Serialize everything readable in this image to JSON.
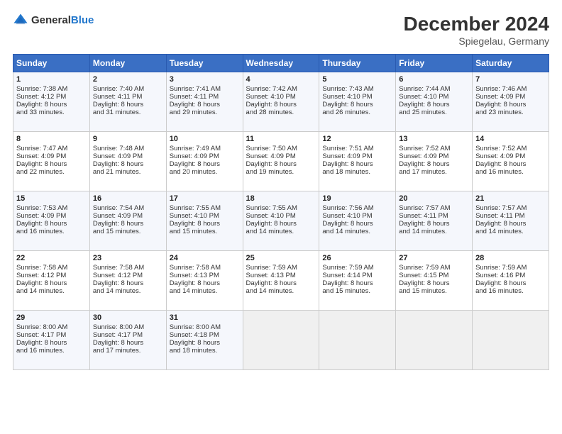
{
  "header": {
    "logo_general": "General",
    "logo_blue": "Blue",
    "month_title": "December 2024",
    "location": "Spiegelau, Germany"
  },
  "weekdays": [
    "Sunday",
    "Monday",
    "Tuesday",
    "Wednesday",
    "Thursday",
    "Friday",
    "Saturday"
  ],
  "weeks": [
    [
      {
        "day": "1",
        "lines": [
          "Sunrise: 7:38 AM",
          "Sunset: 4:12 PM",
          "Daylight: 8 hours",
          "and 33 minutes."
        ]
      },
      {
        "day": "2",
        "lines": [
          "Sunrise: 7:40 AM",
          "Sunset: 4:11 PM",
          "Daylight: 8 hours",
          "and 31 minutes."
        ]
      },
      {
        "day": "3",
        "lines": [
          "Sunrise: 7:41 AM",
          "Sunset: 4:11 PM",
          "Daylight: 8 hours",
          "and 29 minutes."
        ]
      },
      {
        "day": "4",
        "lines": [
          "Sunrise: 7:42 AM",
          "Sunset: 4:10 PM",
          "Daylight: 8 hours",
          "and 28 minutes."
        ]
      },
      {
        "day": "5",
        "lines": [
          "Sunrise: 7:43 AM",
          "Sunset: 4:10 PM",
          "Daylight: 8 hours",
          "and 26 minutes."
        ]
      },
      {
        "day": "6",
        "lines": [
          "Sunrise: 7:44 AM",
          "Sunset: 4:10 PM",
          "Daylight: 8 hours",
          "and 25 minutes."
        ]
      },
      {
        "day": "7",
        "lines": [
          "Sunrise: 7:46 AM",
          "Sunset: 4:09 PM",
          "Daylight: 8 hours",
          "and 23 minutes."
        ]
      }
    ],
    [
      {
        "day": "8",
        "lines": [
          "Sunrise: 7:47 AM",
          "Sunset: 4:09 PM",
          "Daylight: 8 hours",
          "and 22 minutes."
        ]
      },
      {
        "day": "9",
        "lines": [
          "Sunrise: 7:48 AM",
          "Sunset: 4:09 PM",
          "Daylight: 8 hours",
          "and 21 minutes."
        ]
      },
      {
        "day": "10",
        "lines": [
          "Sunrise: 7:49 AM",
          "Sunset: 4:09 PM",
          "Daylight: 8 hours",
          "and 20 minutes."
        ]
      },
      {
        "day": "11",
        "lines": [
          "Sunrise: 7:50 AM",
          "Sunset: 4:09 PM",
          "Daylight: 8 hours",
          "and 19 minutes."
        ]
      },
      {
        "day": "12",
        "lines": [
          "Sunrise: 7:51 AM",
          "Sunset: 4:09 PM",
          "Daylight: 8 hours",
          "and 18 minutes."
        ]
      },
      {
        "day": "13",
        "lines": [
          "Sunrise: 7:52 AM",
          "Sunset: 4:09 PM",
          "Daylight: 8 hours",
          "and 17 minutes."
        ]
      },
      {
        "day": "14",
        "lines": [
          "Sunrise: 7:52 AM",
          "Sunset: 4:09 PM",
          "Daylight: 8 hours",
          "and 16 minutes."
        ]
      }
    ],
    [
      {
        "day": "15",
        "lines": [
          "Sunrise: 7:53 AM",
          "Sunset: 4:09 PM",
          "Daylight: 8 hours",
          "and 16 minutes."
        ]
      },
      {
        "day": "16",
        "lines": [
          "Sunrise: 7:54 AM",
          "Sunset: 4:09 PM",
          "Daylight: 8 hours",
          "and 15 minutes."
        ]
      },
      {
        "day": "17",
        "lines": [
          "Sunrise: 7:55 AM",
          "Sunset: 4:10 PM",
          "Daylight: 8 hours",
          "and 15 minutes."
        ]
      },
      {
        "day": "18",
        "lines": [
          "Sunrise: 7:55 AM",
          "Sunset: 4:10 PM",
          "Daylight: 8 hours",
          "and 14 minutes."
        ]
      },
      {
        "day": "19",
        "lines": [
          "Sunrise: 7:56 AM",
          "Sunset: 4:10 PM",
          "Daylight: 8 hours",
          "and 14 minutes."
        ]
      },
      {
        "day": "20",
        "lines": [
          "Sunrise: 7:57 AM",
          "Sunset: 4:11 PM",
          "Daylight: 8 hours",
          "and 14 minutes."
        ]
      },
      {
        "day": "21",
        "lines": [
          "Sunrise: 7:57 AM",
          "Sunset: 4:11 PM",
          "Daylight: 8 hours",
          "and 14 minutes."
        ]
      }
    ],
    [
      {
        "day": "22",
        "lines": [
          "Sunrise: 7:58 AM",
          "Sunset: 4:12 PM",
          "Daylight: 8 hours",
          "and 14 minutes."
        ]
      },
      {
        "day": "23",
        "lines": [
          "Sunrise: 7:58 AM",
          "Sunset: 4:12 PM",
          "Daylight: 8 hours",
          "and 14 minutes."
        ]
      },
      {
        "day": "24",
        "lines": [
          "Sunrise: 7:58 AM",
          "Sunset: 4:13 PM",
          "Daylight: 8 hours",
          "and 14 minutes."
        ]
      },
      {
        "day": "25",
        "lines": [
          "Sunrise: 7:59 AM",
          "Sunset: 4:13 PM",
          "Daylight: 8 hours",
          "and 14 minutes."
        ]
      },
      {
        "day": "26",
        "lines": [
          "Sunrise: 7:59 AM",
          "Sunset: 4:14 PM",
          "Daylight: 8 hours",
          "and 15 minutes."
        ]
      },
      {
        "day": "27",
        "lines": [
          "Sunrise: 7:59 AM",
          "Sunset: 4:15 PM",
          "Daylight: 8 hours",
          "and 15 minutes."
        ]
      },
      {
        "day": "28",
        "lines": [
          "Sunrise: 7:59 AM",
          "Sunset: 4:16 PM",
          "Daylight: 8 hours",
          "and 16 minutes."
        ]
      }
    ],
    [
      {
        "day": "29",
        "lines": [
          "Sunrise: 8:00 AM",
          "Sunset: 4:17 PM",
          "Daylight: 8 hours",
          "and 16 minutes."
        ]
      },
      {
        "day": "30",
        "lines": [
          "Sunrise: 8:00 AM",
          "Sunset: 4:17 PM",
          "Daylight: 8 hours",
          "and 17 minutes."
        ]
      },
      {
        "day": "31",
        "lines": [
          "Sunrise: 8:00 AM",
          "Sunset: 4:18 PM",
          "Daylight: 8 hours",
          "and 18 minutes."
        ]
      },
      {
        "day": "",
        "lines": []
      },
      {
        "day": "",
        "lines": []
      },
      {
        "day": "",
        "lines": []
      },
      {
        "day": "",
        "lines": []
      }
    ]
  ]
}
